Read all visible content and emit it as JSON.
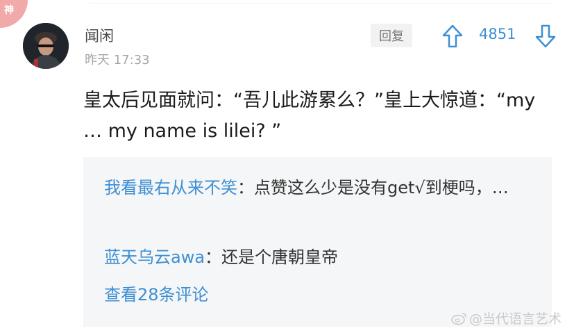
{
  "badge": {
    "label": "神"
  },
  "comment": {
    "username": "闻闲",
    "time": "昨天 17:33",
    "reply_label": "回复",
    "vote_count": "4851",
    "text": "皇太后见面就问：“吾儿此游累么？”皇上大惊道：“my … my name is lilei? ”"
  },
  "replies": [
    {
      "author": "我看最右从来不笑",
      "sep": "：",
      "text": "点赞这么少是没有get√到梗吗，…"
    },
    {
      "author": "蓝天乌云awa",
      "sep": "：",
      "text": "还是个唐朝皇帝"
    }
  ],
  "view_more_label": "查看28条评论",
  "watermark": {
    "text": "@当代语言艺术"
  },
  "colors": {
    "accent": "#3d8fd4",
    "badge": "#f2a9a9",
    "panel": "#f5f6f7"
  }
}
